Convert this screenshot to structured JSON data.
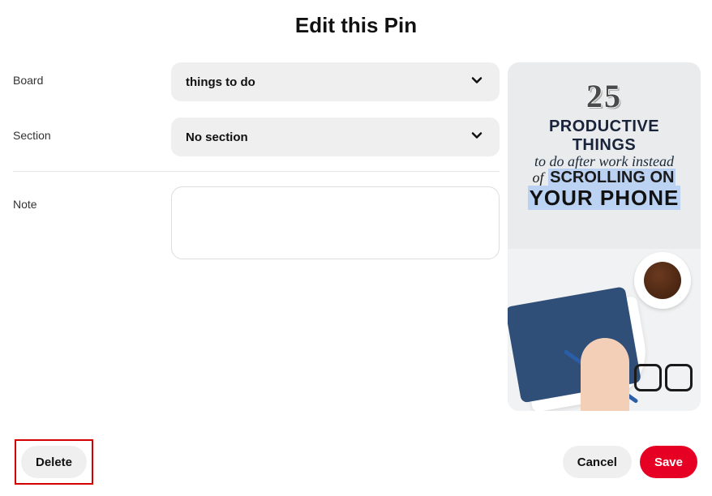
{
  "title": "Edit this Pin",
  "labels": {
    "board": "Board",
    "section": "Section",
    "note": "Note"
  },
  "fields": {
    "board_value": "things to do",
    "section_value": "No section",
    "note_value": "",
    "note_placeholder": ""
  },
  "preview": {
    "number": "25",
    "line1": "PRODUCTIVE THINGS",
    "line2": "to do after work instead",
    "line3_of": "of",
    "line3_rest": "SCROLLING ON",
    "line4": "YOUR PHONE"
  },
  "buttons": {
    "delete": "Delete",
    "cancel": "Cancel",
    "save": "Save"
  }
}
